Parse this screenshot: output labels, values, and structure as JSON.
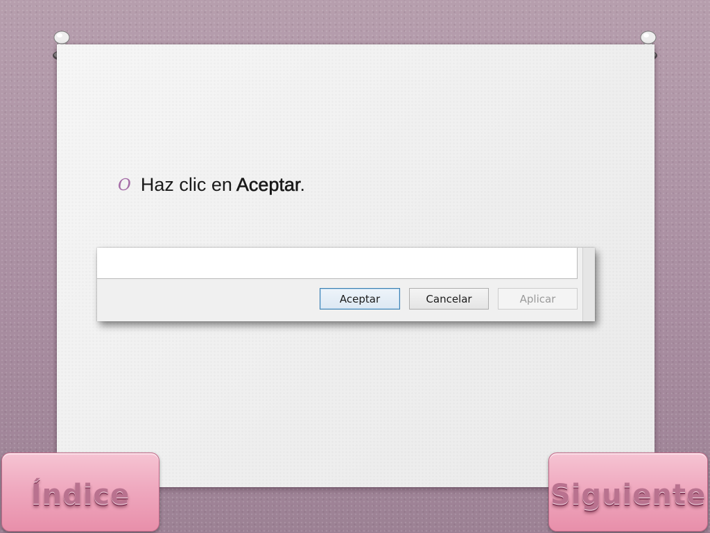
{
  "slide": {
    "bullet_mark": "O",
    "text_prefix": "Haz clic en ",
    "text_bold": "Aceptar",
    "text_suffix": "."
  },
  "dialog": {
    "buttons": {
      "ok": "Aceptar",
      "cancel": "Cancelar",
      "apply": "Aplicar"
    }
  },
  "nav": {
    "prev_label": "Índice",
    "next_label": "Siguiente"
  },
  "colors": {
    "background": "#ad93a5",
    "bullet": "#a46aa6",
    "nav_button": "#efa9bf",
    "nav_text": "#b9728f"
  },
  "icons": {
    "pin": "pushpin-icon"
  }
}
